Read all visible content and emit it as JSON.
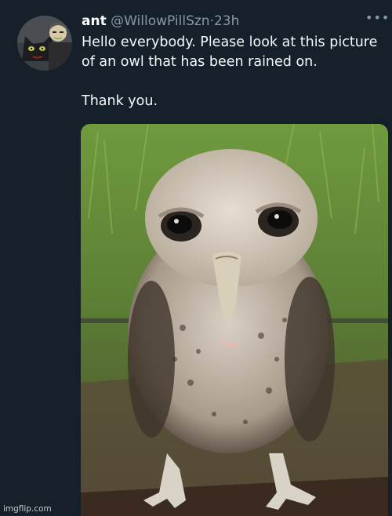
{
  "tweet": {
    "display_name": "ant",
    "handle": "@WillowPillSzn",
    "separator": "·",
    "time": "23h",
    "more_icon": "more-icon",
    "text_lines": [
      "Hello everybody. Please look at this picture",
      "of an owl that has been rained on."
    ],
    "text_second": "Thank you.",
    "avatar_icon": "cartoon-avatar",
    "media_alt": "wet owl photo"
  },
  "watermark": "imgflip.com",
  "colors": {
    "background": "#15202b",
    "secondary_text": "#8b98a5",
    "primary_text": "#ffffff"
  }
}
